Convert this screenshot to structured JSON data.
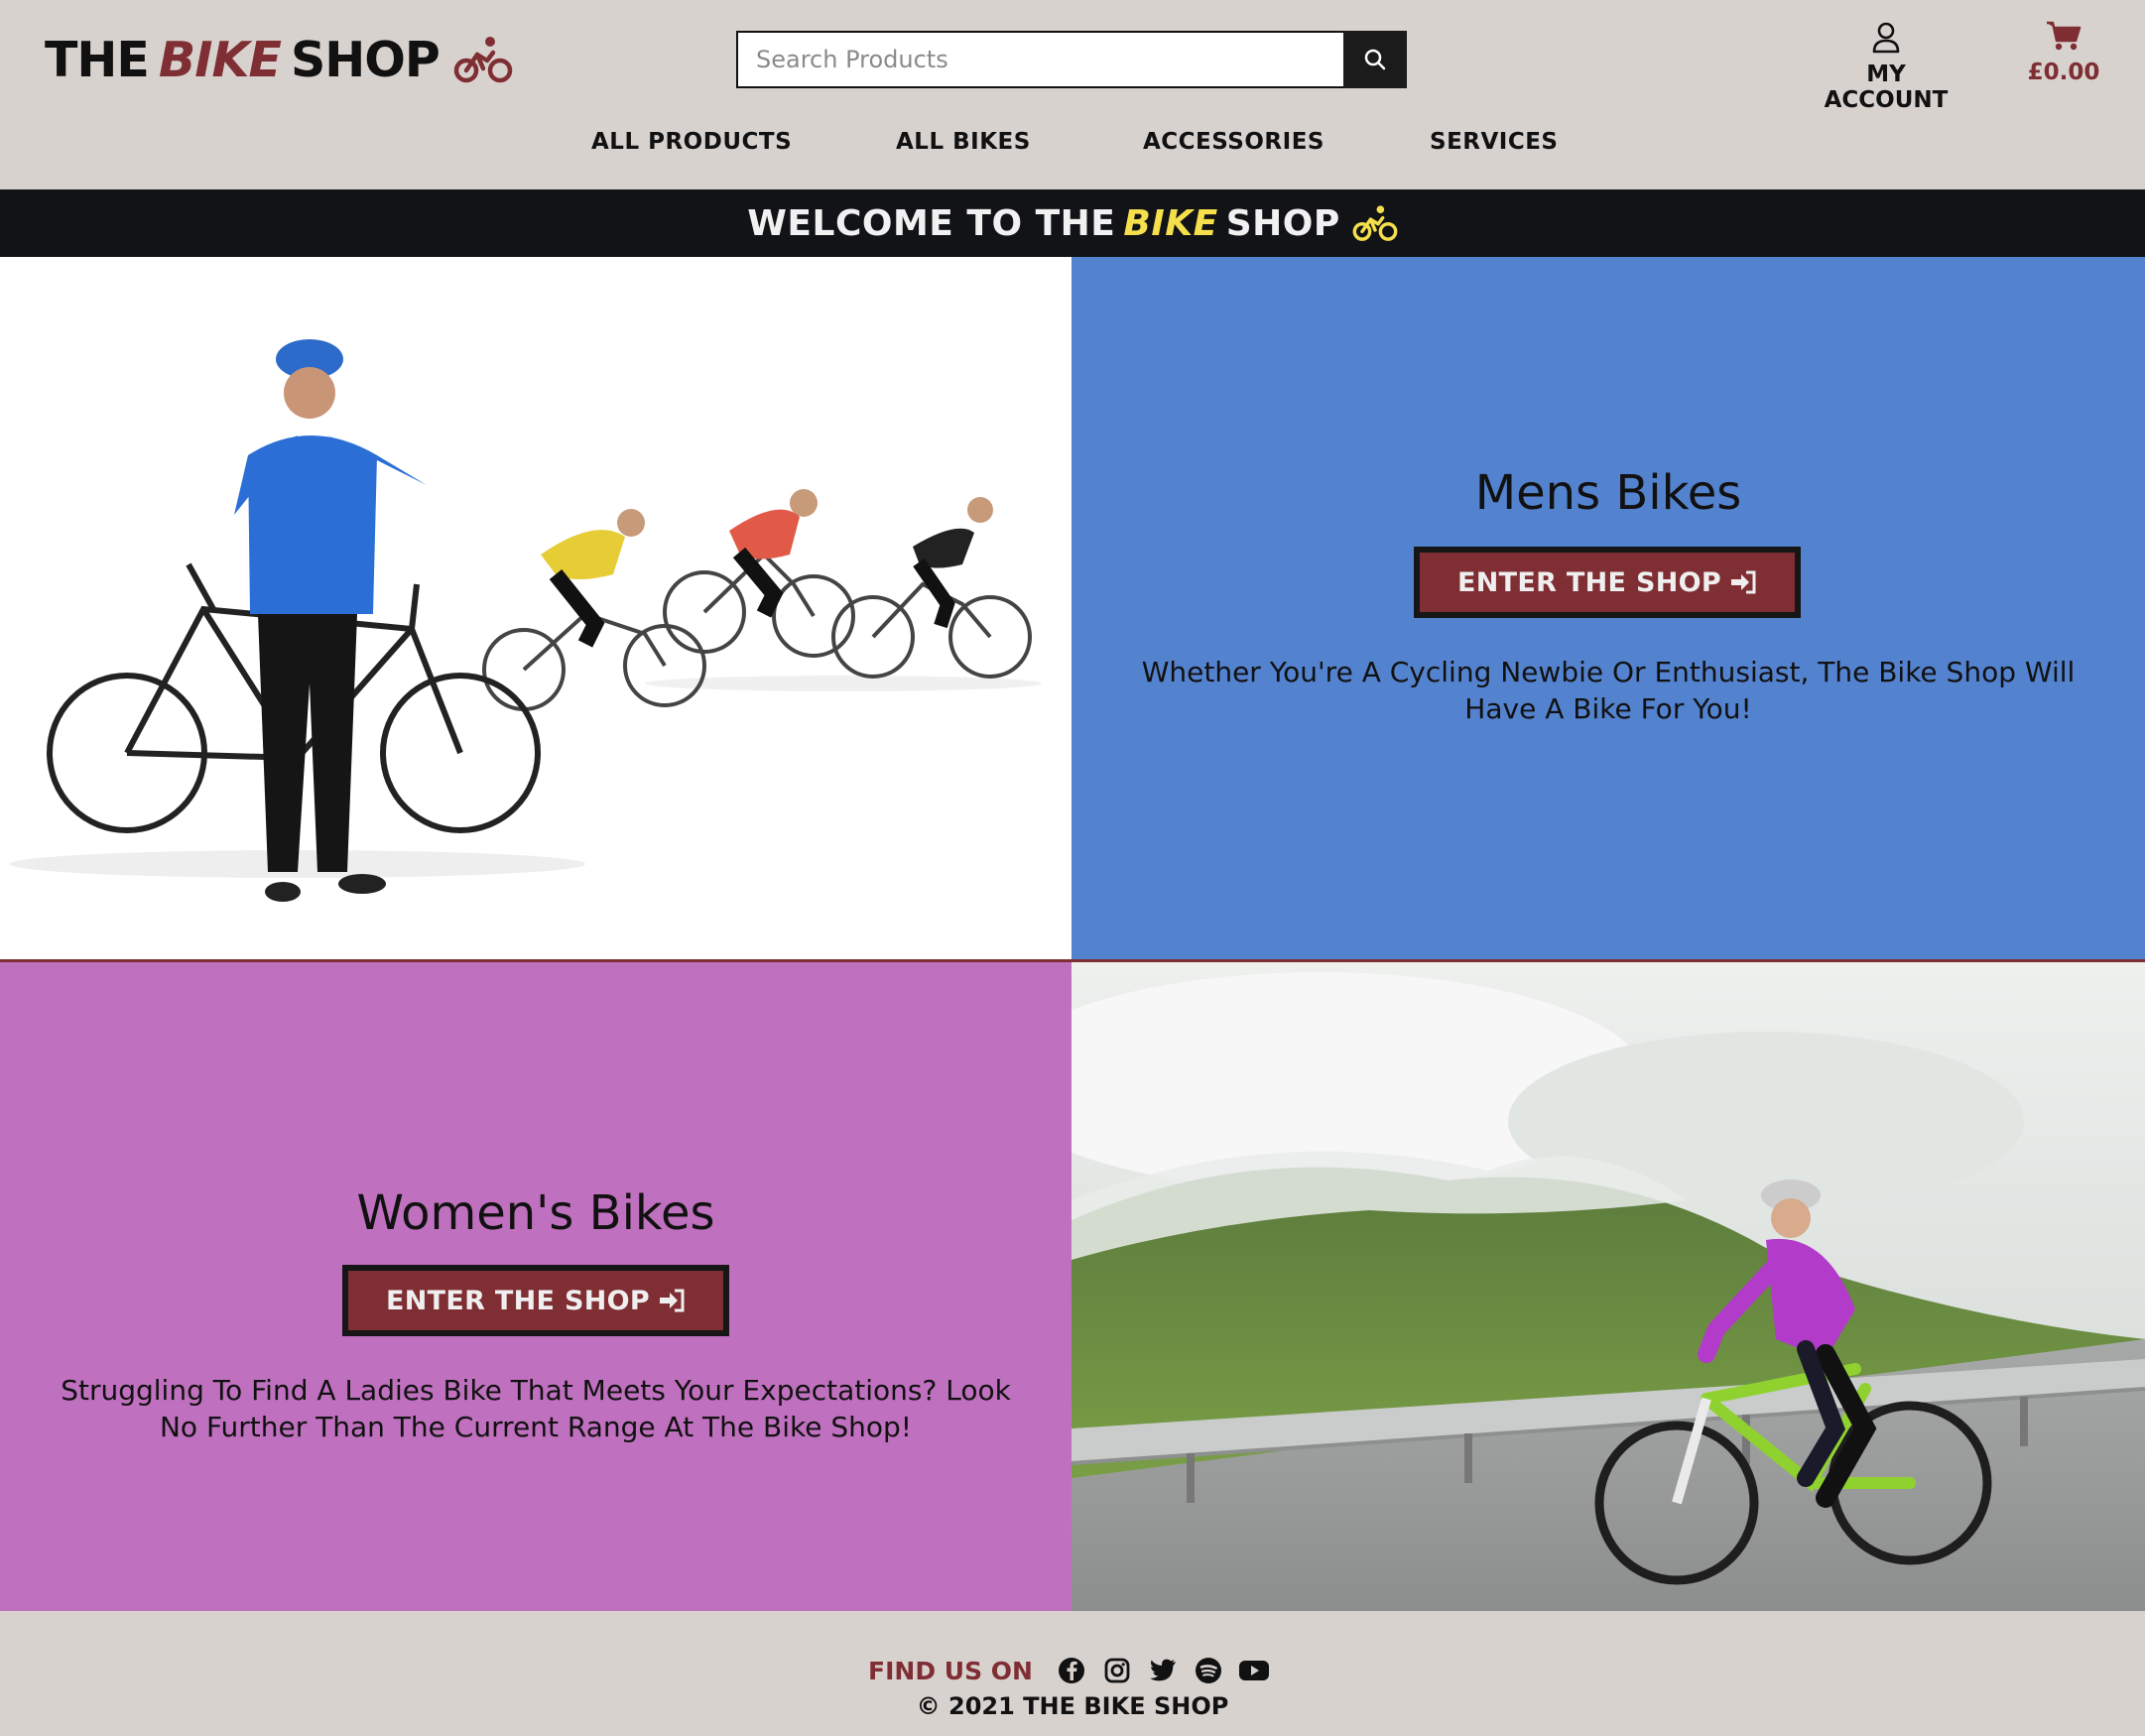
{
  "header": {
    "logo": {
      "the": "THE",
      "bike": "BIKE",
      "shop": "SHOP",
      "icon": "cyclist-icon"
    },
    "search": {
      "placeholder": "Search Products",
      "button_icon": "search-icon"
    },
    "account": {
      "label": "MY ACCOUNT",
      "icon": "user-icon"
    },
    "cart": {
      "total": "£0.00",
      "icon": "cart-icon"
    }
  },
  "nav": {
    "items": [
      {
        "label": "ALL PRODUCTS"
      },
      {
        "label": "ALL BIKES"
      },
      {
        "label": "ACCESSORIES"
      },
      {
        "label": "SERVICES"
      }
    ]
  },
  "banner": {
    "prefix": "WELCOME TO THE",
    "bike": "BIKE",
    "shop": "SHOP",
    "icon": "cyclist-icon"
  },
  "mens": {
    "title": "Mens Bikes",
    "button": "ENTER THE SHOP",
    "button_icon": "sign-in-icon",
    "text": "Whether You're A Cycling Newbie Or Enthusiast, The Bike Shop Will Have A Bike For You!"
  },
  "womens": {
    "title": "Women's Bikes",
    "button": "ENTER THE SHOP",
    "button_icon": "sign-in-icon",
    "text": "Struggling To Find A Ladies Bike That Meets Your Expectations? Look No Further Than The Current Range At The Bike Shop!"
  },
  "footer": {
    "find_label": "FIND US ON",
    "socials": [
      "facebook-icon",
      "instagram-icon",
      "twitter-icon",
      "spotify-icon",
      "youtube-icon"
    ],
    "copyright": "© 2021 THE BIKE SHOP"
  },
  "colors": {
    "header_bg": "#d8d2cf",
    "brand_red": "#7f2e33",
    "banner_bg": "#121316",
    "banner_accent": "#f5df4d",
    "mens_bg": "#5382cf",
    "womens_bg": "#bf70be"
  }
}
